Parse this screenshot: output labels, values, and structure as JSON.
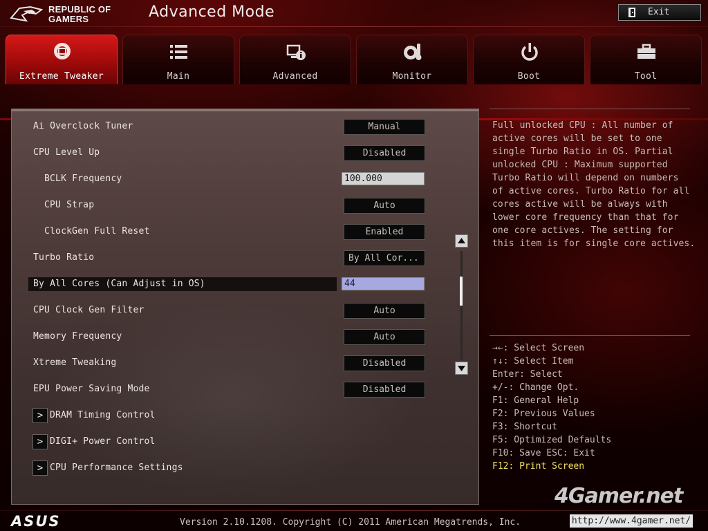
{
  "header": {
    "brand_line1": "REPUBLIC OF",
    "brand_line2": "GAMERS",
    "mode_title": "Advanced Mode",
    "exit_label": "Exit"
  },
  "tabs": [
    {
      "label": "Extreme Tweaker",
      "icon": "extreme-tweaker-icon",
      "active": true
    },
    {
      "label": "Main",
      "icon": "list-icon",
      "active": false
    },
    {
      "label": "Advanced",
      "icon": "advanced-info-icon",
      "active": false
    },
    {
      "label": "Monitor",
      "icon": "monitor-gauge-icon",
      "active": false
    },
    {
      "label": "Boot",
      "icon": "power-icon",
      "active": false
    },
    {
      "label": "Tool",
      "icon": "toolbox-icon",
      "active": false
    }
  ],
  "settings": [
    {
      "label": "Ai Overclock Tuner",
      "value": "Manual",
      "type": "select"
    },
    {
      "label": "CPU Level Up",
      "value": "Disabled",
      "type": "select"
    },
    {
      "label": "BCLK Frequency",
      "value": "100.000",
      "type": "input"
    },
    {
      "label": "CPU Strap",
      "value": "Auto",
      "type": "select"
    },
    {
      "label": "ClockGen Full Reset",
      "value": "Enabled",
      "type": "select"
    },
    {
      "label": "Turbo Ratio",
      "value": "By All Cor...",
      "type": "select"
    },
    {
      "label": "By All Cores (Can Adjust in OS)",
      "value": "44",
      "type": "input"
    },
    {
      "label": "CPU Clock Gen Filter",
      "value": "Auto",
      "type": "select"
    },
    {
      "label": "Memory Frequency",
      "value": "Auto",
      "type": "select"
    },
    {
      "label": "Xtreme Tweaking",
      "value": "Disabled",
      "type": "select"
    },
    {
      "label": "EPU Power Saving Mode",
      "value": "Disabled",
      "type": "select"
    },
    {
      "label": "DRAM Timing Control",
      "type": "submenu"
    },
    {
      "label": "DIGI+ Power Control",
      "type": "submenu"
    },
    {
      "label": "CPU Performance Settings",
      "type": "submenu"
    }
  ],
  "help": {
    "lines": [
      "Full unlocked CPU : All number of",
      "active cores will be set to one",
      "single Turbo Ratio in OS. Partial",
      "unlocked CPU : Maximum supported",
      "Turbo Ratio will depend on numbers",
      "of active cores. Turbo Ratio for all",
      "cores active will be always with",
      "lower core frequency than that for",
      "one core actives. The setting for",
      "this item is for single core actives."
    ]
  },
  "keys": [
    "→←: Select Screen",
    "↑↓: Select Item",
    "Enter: Select",
    "+/-: Change Opt.",
    "F1: General Help",
    "F2: Previous Values",
    "F3: Shortcut",
    "F5: Optimized Defaults",
    "F10: Save  ESC: Exit",
    "F12: Print Screen"
  ],
  "footer": {
    "brand": "ASUS",
    "version": "Version 2.10.1208. Copyright (C) 2011 American Megatrends, Inc."
  },
  "watermark": {
    "brand": "4Gamer.net",
    "url": "http://www.4gamer.net/"
  },
  "colors": {
    "accent_red": "#c01818",
    "selected_input": "#a8a8e0",
    "hotkey_yellow": "#f0e060"
  }
}
